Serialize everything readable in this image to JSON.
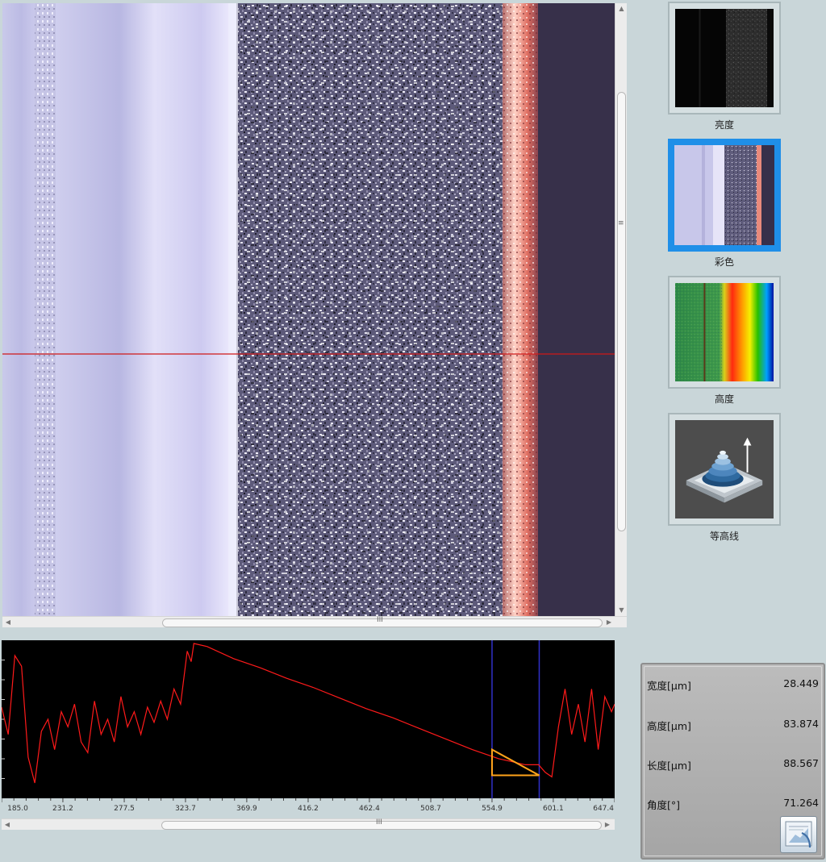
{
  "modes": [
    {
      "label": "亮度",
      "icon": "brightness-image-icon",
      "selected": false
    },
    {
      "label": "彩色",
      "icon": "color-image-icon",
      "selected": true
    },
    {
      "label": "高度",
      "icon": "height-map-icon",
      "selected": false
    },
    {
      "label": "等高线",
      "icon": "contour-3d-icon",
      "selected": false
    }
  ],
  "colors": {
    "selection_border": "#1f8fe8",
    "profile_line": "#ff1a1a",
    "cursor_line": "#3030c8",
    "measure_triangle": "#ffa31a",
    "scan_line": "#d01818"
  },
  "measurements": {
    "width": {
      "label": "宽度[μm]",
      "value": "28.449"
    },
    "height": {
      "label": "高度[μm]",
      "value": "83.874"
    },
    "length": {
      "label": "长度[μm]",
      "value": "88.567"
    },
    "angle": {
      "label": "角度[°]",
      "value": "71.264"
    }
  },
  "scrollbars": {
    "grip_h": "III",
    "grip_v": "≡"
  },
  "chart_data": {
    "type": "line",
    "title": "",
    "xlabel": "",
    "ylabel": "",
    "x_ticks": [
      "185.0",
      "231.2",
      "277.5",
      "323.7",
      "369.9",
      "416.2",
      "462.4",
      "508.7",
      "554.9",
      "601.1",
      "647.4"
    ],
    "xlim": [
      185.0,
      647.4
    ],
    "ylim": [
      0,
      100
    ],
    "series": [
      {
        "x": [
          185.0,
          190.0,
          195.0,
          200.0,
          205.0,
          210.0,
          215.0,
          220.0,
          225.0,
          230.0,
          235.0,
          240.0,
          245.0,
          250.0,
          255.0,
          260.0,
          265.0,
          270.0,
          275.0,
          280.0,
          285.0,
          290.0,
          295.0,
          300.0,
          305.0,
          310.0,
          315.0,
          320.0,
          325.0,
          328.0,
          330.0,
          340.0,
          360.0,
          380.0,
          400.0,
          420.0,
          440.0,
          460.0,
          480.0,
          500.0,
          520.0,
          540.0,
          560.0,
          570.0,
          580.0,
          590.0,
          595.0,
          600.0,
          605.0,
          610.0,
          615.0,
          620.0,
          625.0,
          630.0,
          635.0,
          640.0,
          645.0,
          647.4
        ],
        "y": [
          58,
          40,
          92,
          85,
          25,
          8,
          42,
          50,
          30,
          55,
          45,
          60,
          35,
          28,
          62,
          40,
          50,
          35,
          65,
          45,
          55,
          40,
          58,
          48,
          62,
          50,
          70,
          60,
          95,
          88,
          100,
          98,
          90,
          84,
          77,
          71,
          64,
          57,
          51,
          44,
          37,
          30,
          24,
          22,
          20,
          20,
          15,
          12,
          45,
          70,
          40,
          60,
          35,
          70,
          30,
          65,
          55,
          60
        ]
      }
    ],
    "cursors_x": [
      554.9,
      590.5
    ],
    "triangle": {
      "x": [
        554.9,
        554.9,
        590.5
      ],
      "y": [
        30,
        13,
        13
      ]
    },
    "grid": false,
    "legend": "none"
  }
}
